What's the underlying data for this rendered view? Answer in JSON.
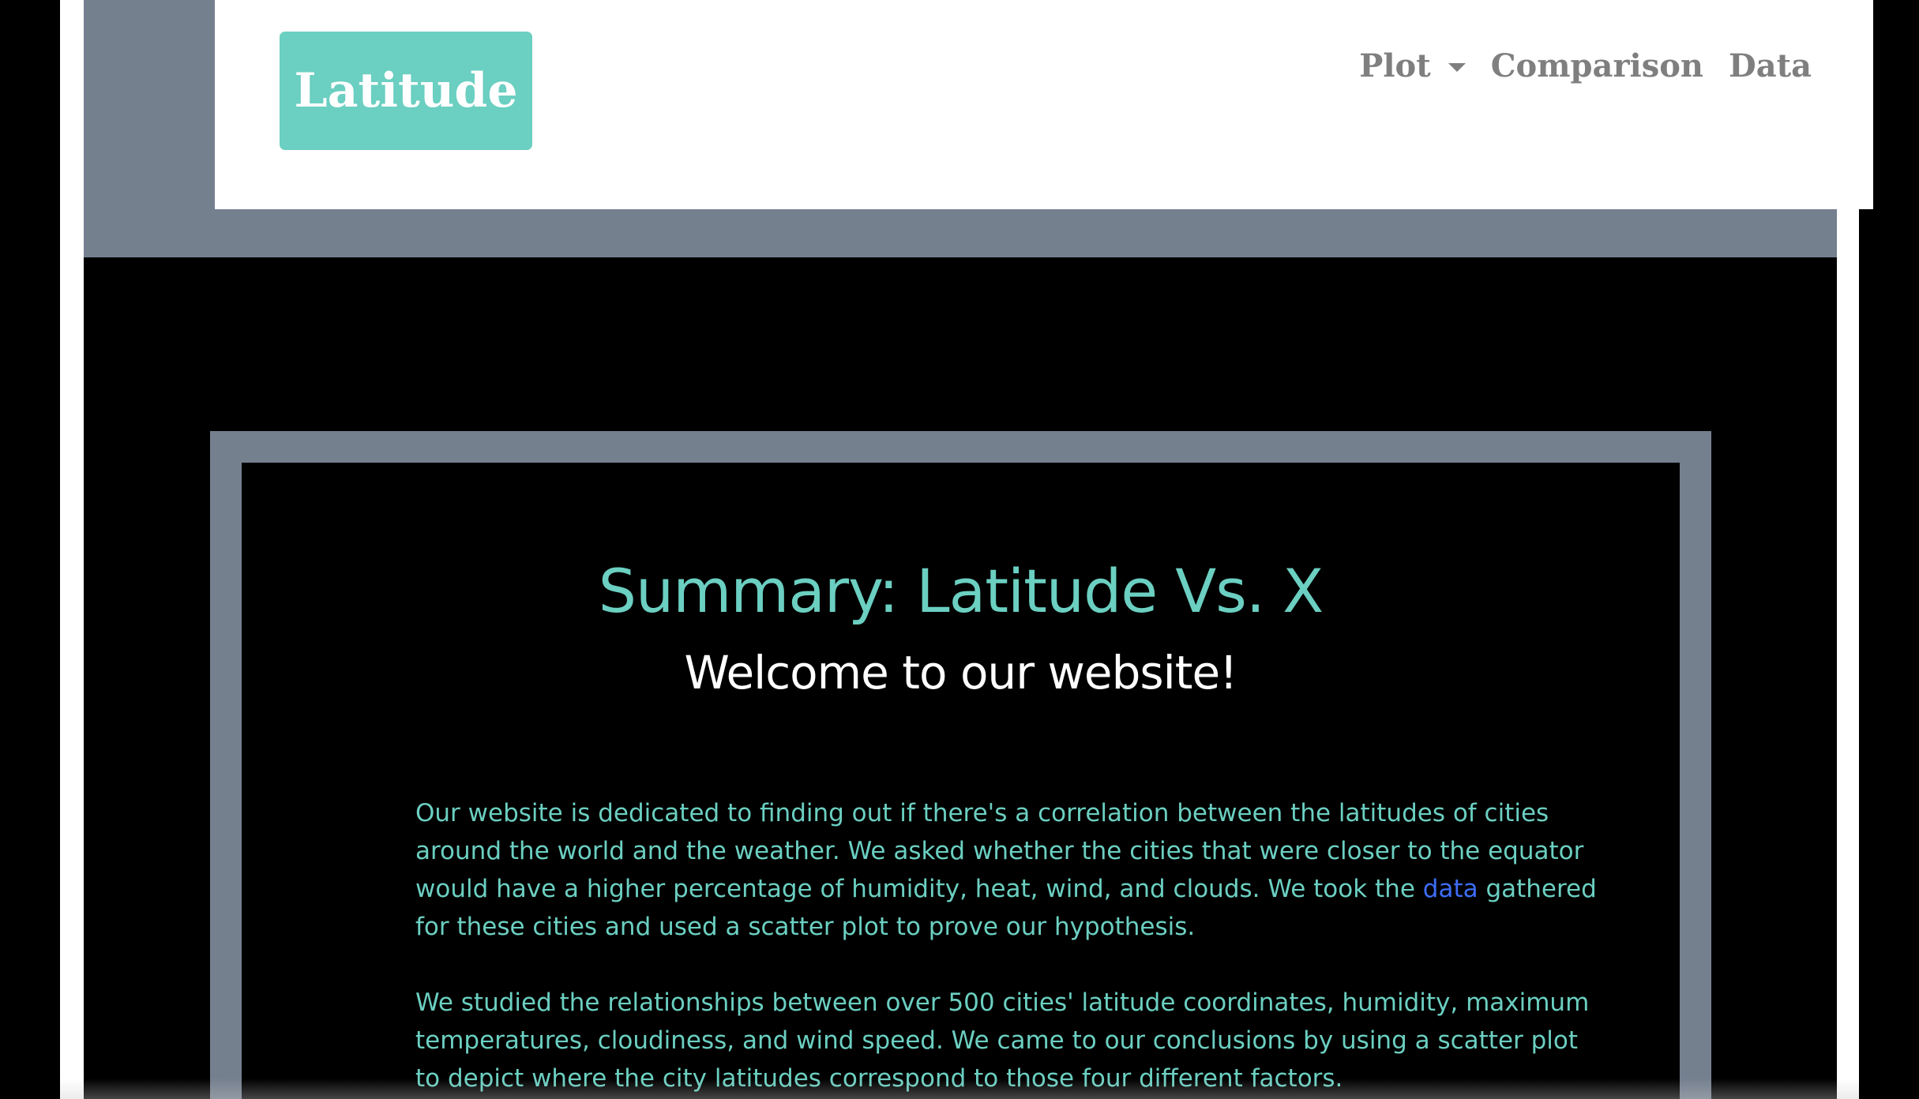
{
  "header": {
    "brand": "Latitude",
    "nav": {
      "plot_label": "Plot",
      "comparison_label": "Comparison",
      "data_label": "Data"
    }
  },
  "main": {
    "title": "Summary: Latitude Vs. X",
    "subtitle": "Welcome to our website!",
    "paragraph1": {
      "before_link": "Our website is dedicated to finding out if there's a correlation between the latitudes of cities around the world and the weather. We asked whether the cities that were closer to the equator would have a higher percentage of humidity, heat, wind, and clouds. We took the ",
      "link_text": "data",
      "after_link": " gathered for these cities and used a scatter plot to prove our hypothesis."
    },
    "paragraph2": "We studied the relationships between over 500 cities' latitude coordinates, humidity, maximum temperatures, cloudiness, and wind speed. We came to our conclusions by using a scatter plot to depict where the city latitudes correspond to those four different factors."
  },
  "colors": {
    "accent": "#6bcfc1",
    "frame": "#75808f",
    "link": "#3d6df5",
    "nav_text": "#7f7f7f"
  }
}
